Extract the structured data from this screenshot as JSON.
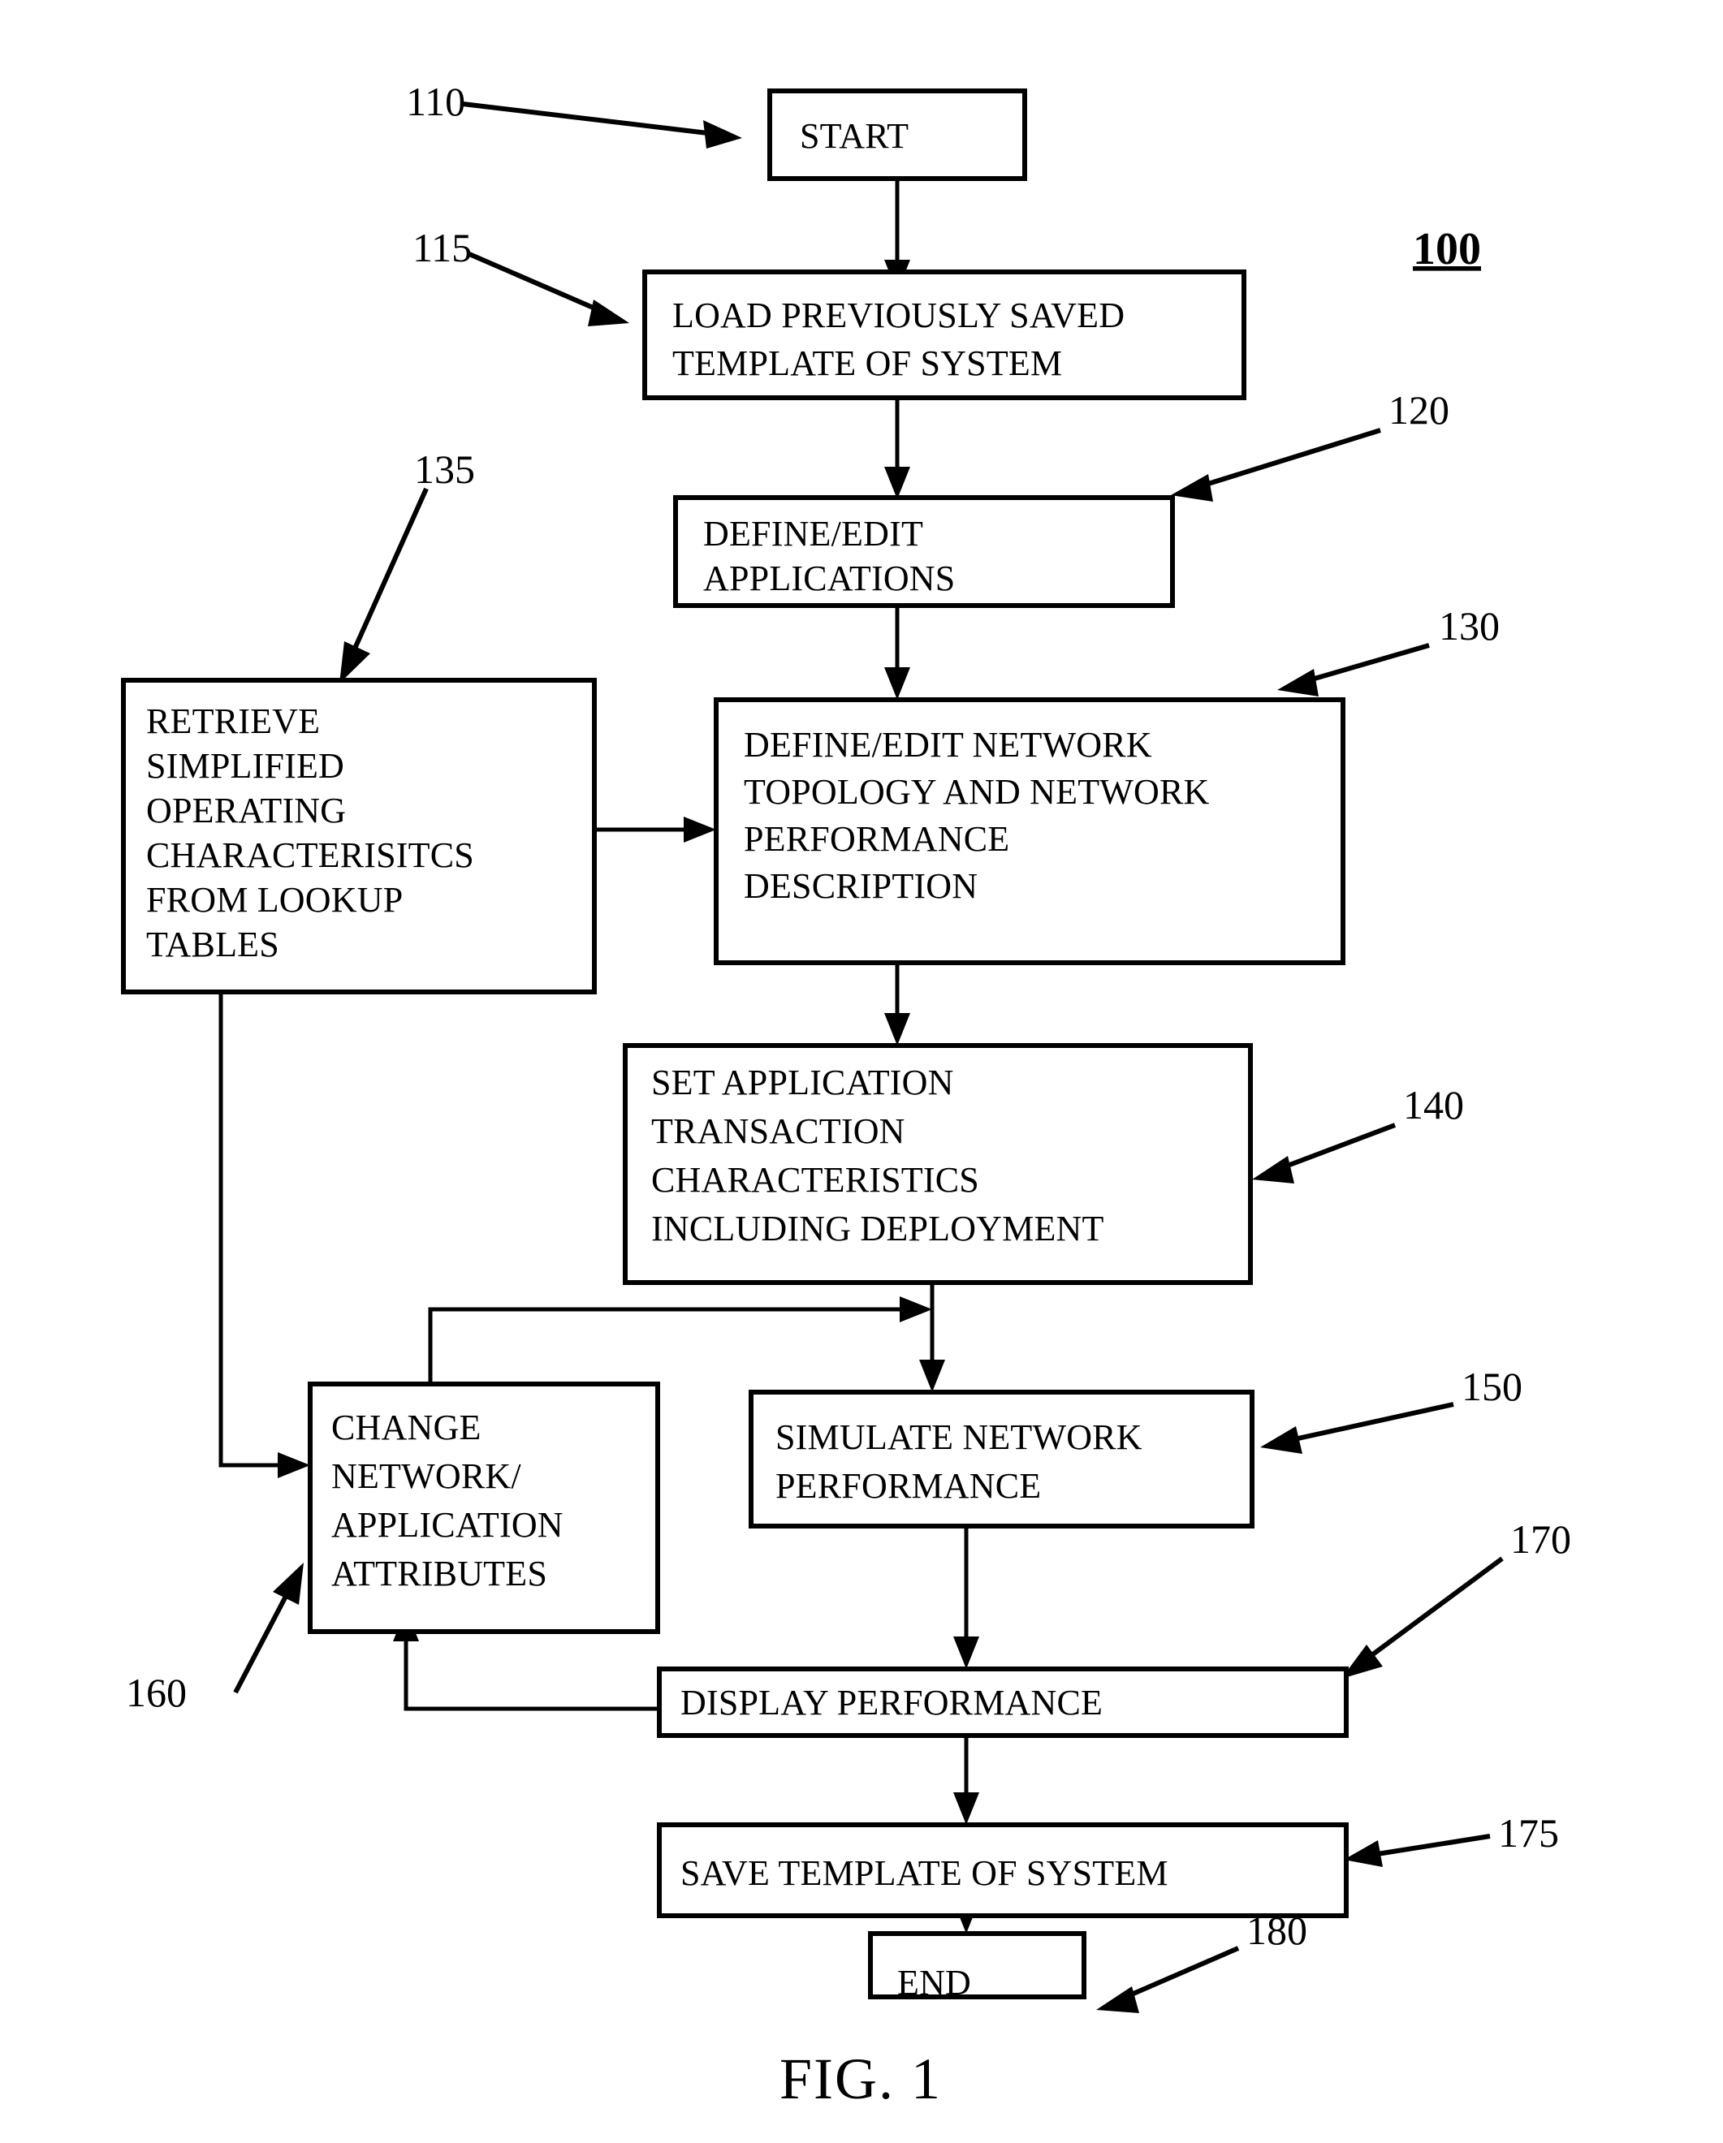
{
  "figure": {
    "caption": "FIG. 1",
    "system_number": "100"
  },
  "nodes": [
    {
      "id": "start",
      "ref": "110",
      "lines": [
        "START"
      ]
    },
    {
      "id": "load",
      "ref": "115",
      "lines": [
        "LOAD PREVIOUSLY SAVED",
        "TEMPLATE OF SYSTEM"
      ]
    },
    {
      "id": "defapp",
      "ref": "120",
      "lines": [
        "DEFINE/EDIT",
        "APPLICATIONS"
      ]
    },
    {
      "id": "retrieve",
      "ref": "135",
      "lines": [
        "RETRIEVE",
        "SIMPLIFIED",
        "OPERATING",
        "CHARACTERISITCS",
        "FROM LOOKUP",
        "TABLES"
      ]
    },
    {
      "id": "defnet",
      "ref": "130",
      "lines": [
        "DEFINE/EDIT NETWORK",
        "TOPOLOGY AND NETWORK",
        "PERFORMANCE",
        "DESCRIPTION"
      ]
    },
    {
      "id": "settrans",
      "ref": "140",
      "lines": [
        "SET APPLICATION",
        "TRANSACTION",
        "CHARACTERISTICS",
        "INCLUDING DEPLOYMENT"
      ]
    },
    {
      "id": "change",
      "ref": "160",
      "lines": [
        "CHANGE",
        "NETWORK/",
        "APPLICATION",
        "ATTRIBUTES"
      ]
    },
    {
      "id": "simulate",
      "ref": "150",
      "lines": [
        "SIMULATE NETWORK",
        "PERFORMANCE"
      ]
    },
    {
      "id": "display",
      "ref": "170",
      "lines": [
        "DISPLAY PERFORMANCE"
      ]
    },
    {
      "id": "save",
      "ref": "175",
      "lines": [
        "SAVE TEMPLATE OF SYSTEM"
      ]
    },
    {
      "id": "end",
      "ref": "180",
      "lines": [
        "END"
      ]
    }
  ],
  "reference_numerals": {
    "n110": "110",
    "n115": "115",
    "n120": "120",
    "n130": "130",
    "n135": "135",
    "n140": "140",
    "n150": "150",
    "n160": "160",
    "n170": "170",
    "n175": "175",
    "n180": "180"
  },
  "text": {
    "start": "START",
    "load_l1": "LOAD PREVIOUSLY SAVED",
    "load_l2": "TEMPLATE OF SYSTEM",
    "defapp_l1": "DEFINE/EDIT",
    "defapp_l2": "APPLICATIONS",
    "retrieve_l1": "RETRIEVE",
    "retrieve_l2": "SIMPLIFIED",
    "retrieve_l3": "OPERATING",
    "retrieve_l4": "CHARACTERISITCS",
    "retrieve_l5": "FROM LOOKUP",
    "retrieve_l6": "TABLES",
    "defnet_l1": "DEFINE/EDIT NETWORK",
    "defnet_l2": "TOPOLOGY AND NETWORK",
    "defnet_l3": "PERFORMANCE",
    "defnet_l4": "DESCRIPTION",
    "settrans_l1": "SET APPLICATION",
    "settrans_l2": "TRANSACTION",
    "settrans_l3": "CHARACTERISTICS",
    "settrans_l4": "INCLUDING DEPLOYMENT",
    "change_l1": "CHANGE",
    "change_l2": "NETWORK/",
    "change_l3": "APPLICATION",
    "change_l4": "ATTRIBUTES",
    "simulate_l1": "SIMULATE NETWORK",
    "simulate_l2": "PERFORMANCE",
    "display_l1": "DISPLAY PERFORMANCE",
    "save_l1": "SAVE TEMPLATE OF SYSTEM",
    "end": "END",
    "fig_caption": "FIG. 1",
    "system_num": "100"
  }
}
